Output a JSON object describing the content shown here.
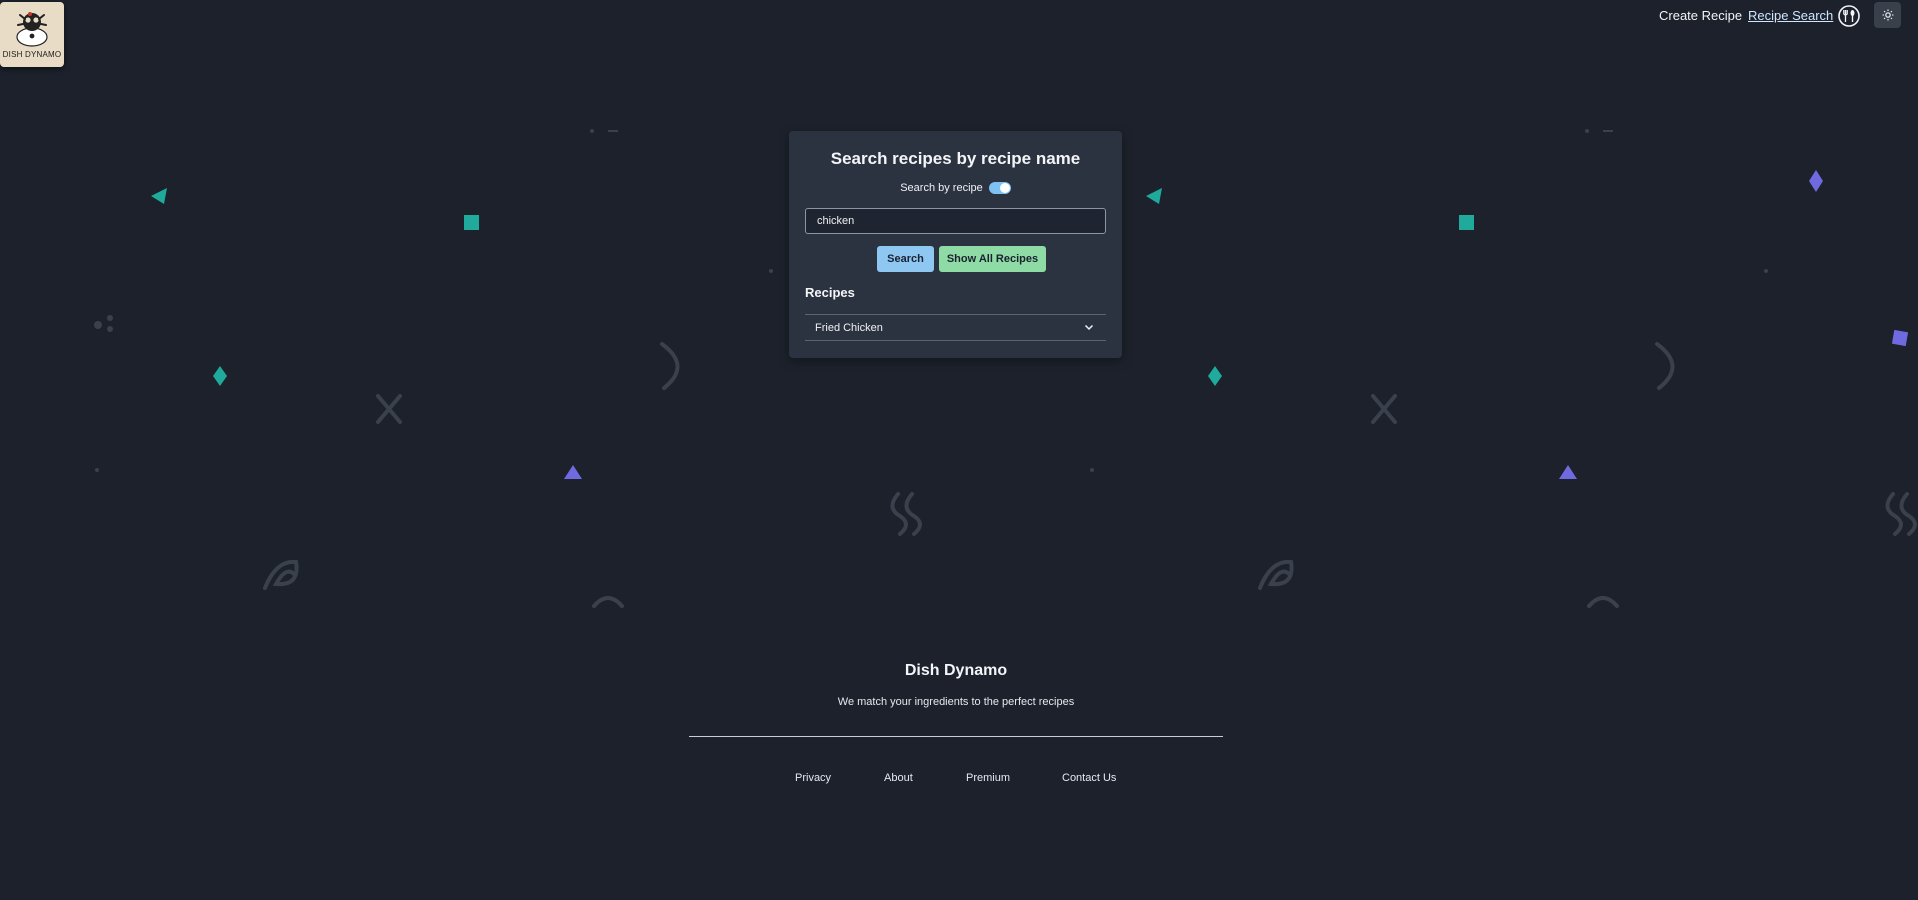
{
  "brand": {
    "logo_text": "DISH DYNAMO"
  },
  "nav": {
    "create_recipe": "Create Recipe",
    "recipe_search": "Recipe Search",
    "icons": [
      "dining-icon",
      "theme-toggle-icon"
    ]
  },
  "search_card": {
    "title": "Search recipes by recipe name",
    "toggle_label": "Search by recipe",
    "toggle_on": true,
    "query": "chicken",
    "search_button": "Search",
    "show_all_button": "Show All Recipes",
    "results_heading": "Recipes",
    "results": [
      {
        "name": "Fried Chicken"
      }
    ]
  },
  "footer": {
    "title": "Dish Dynamo",
    "tagline": "We match your ingredients to the perfect recipes",
    "links": [
      "Privacy",
      "About",
      "Premium",
      "Contact Us"
    ]
  },
  "colors": {
    "background": "#1c212b",
    "card": "#2c3340",
    "search_button": "#8ec7f2",
    "show_all_button": "#8fdba5",
    "teal_shape": "#1faa9b",
    "purple_shape": "#6f6ae0"
  }
}
